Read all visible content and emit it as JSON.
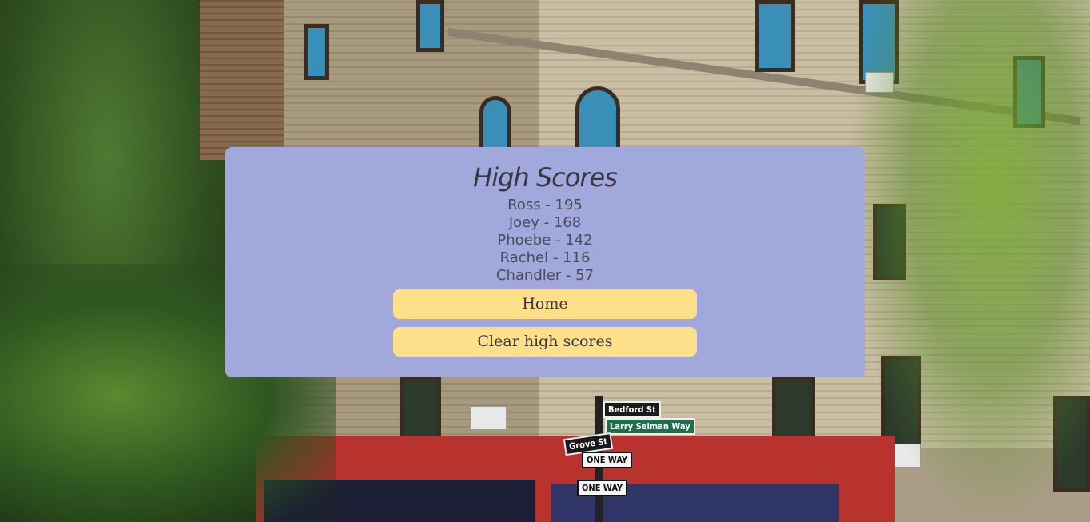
{
  "card": {
    "title": "High Scores",
    "scores": [
      {
        "text": "Ross - 195"
      },
      {
        "text": "Joey - 168"
      },
      {
        "text": "Phoebe - 142"
      },
      {
        "text": "Rachel - 116"
      },
      {
        "text": "Chandler - 57"
      }
    ],
    "home_label": "Home",
    "clear_label": "Clear high scores"
  },
  "background": {
    "signs": {
      "bedford": "Bedford St",
      "larry": "Larry Selman Way",
      "grove": "Grove St",
      "one_way_1": "ONE WAY",
      "one_way_2": "ONE WAY"
    }
  },
  "colors": {
    "card_bg": "#a0a8dc",
    "button_bg": "#ffe08a",
    "text": "#3b3441"
  }
}
